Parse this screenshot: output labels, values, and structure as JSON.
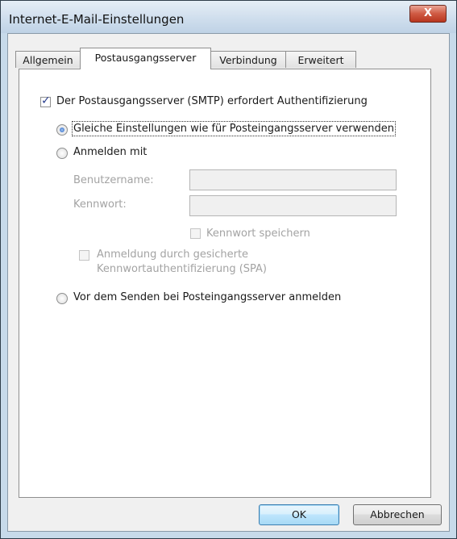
{
  "window": {
    "title": "Internet-E-Mail-Einstellungen",
    "close_label": "X"
  },
  "tabs": [
    {
      "label": "Allgemein"
    },
    {
      "label": "Postausgangsserver"
    },
    {
      "label": "Verbindung"
    },
    {
      "label": "Erweitert"
    }
  ],
  "active_tab": "Postausgangsserver",
  "smtp_auth": {
    "label": "Der Postausgangsserver (SMTP) erfordert Authentifizierung",
    "checked": true
  },
  "options": {
    "same_settings": {
      "label": "Gleiche Einstellungen wie für Posteingangsserver verwenden",
      "selected": true
    },
    "login_with": {
      "label": "Anmelden mit",
      "selected": false
    },
    "before_send": {
      "label": "Vor dem Senden bei Posteingangsserver anmelden",
      "selected": false
    }
  },
  "login": {
    "username_label": "Benutzername:",
    "username_value": "",
    "password_label": "Kennwort:",
    "password_value": "",
    "remember_password": {
      "label": "Kennwort speichern",
      "checked": false
    },
    "spa_line1": "Anmeldung durch gesicherte",
    "spa_line2": "Kennwortauthentifizierung (SPA)"
  },
  "buttons": {
    "ok": "OK",
    "cancel": "Abbrechen"
  }
}
